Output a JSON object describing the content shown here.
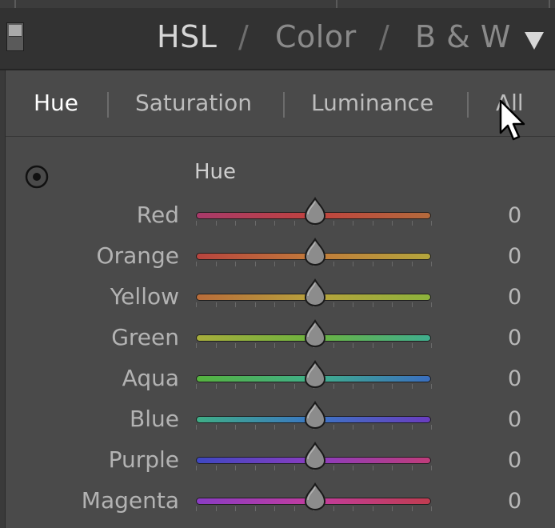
{
  "header": {
    "tabs": [
      {
        "label": "HSL",
        "active": true
      },
      {
        "label": "Color",
        "active": false
      },
      {
        "label": "B & W",
        "active": false
      }
    ],
    "separator": "/",
    "collapse_icon": "triangle-down-icon"
  },
  "subtabs": [
    {
      "label": "Hue",
      "active": true
    },
    {
      "label": "Saturation",
      "active": false
    },
    {
      "label": "Luminance",
      "active": false
    },
    {
      "label": "All",
      "active": false
    }
  ],
  "section": {
    "title": "Hue",
    "target_icon": "targeted-adjustment-icon"
  },
  "sliders": [
    {
      "label": "Red",
      "value": "0",
      "gradient": [
        "#a83a6a",
        "#c0423e",
        "#b36a3c"
      ]
    },
    {
      "label": "Orange",
      "value": "0",
      "gradient": [
        "#b8443e",
        "#c27a3a",
        "#b4a63c"
      ]
    },
    {
      "label": "Yellow",
      "value": "0",
      "gradient": [
        "#b96c3a",
        "#b8a23c",
        "#8db33c"
      ]
    },
    {
      "label": "Green",
      "value": "0",
      "gradient": [
        "#a7ad3c",
        "#6cb33e",
        "#3fae8e"
      ]
    },
    {
      "label": "Aqua",
      "value": "0",
      "gradient": [
        "#56b23e",
        "#3fb08a",
        "#3a6ec0"
      ]
    },
    {
      "label": "Blue",
      "value": "0",
      "gradient": [
        "#3fae86",
        "#3a76c4",
        "#6a3cc0"
      ]
    },
    {
      "label": "Purple",
      "value": "0",
      "gradient": [
        "#3e48c2",
        "#8a3cc0",
        "#c03c7a"
      ]
    },
    {
      "label": "Magenta",
      "value": "0",
      "gradient": [
        "#8a3cc4",
        "#c23c9e",
        "#c03c50"
      ]
    }
  ]
}
